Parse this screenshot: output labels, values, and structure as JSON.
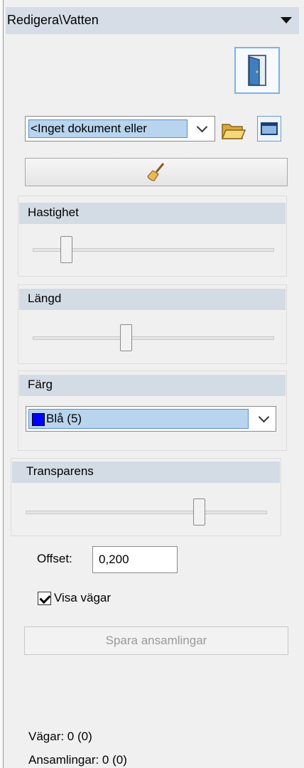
{
  "panel": {
    "title": "Redigera\\Vatten"
  },
  "document": {
    "selected": "<Inget dokument eller"
  },
  "speed": {
    "label": "Hastighet",
    "value_fraction": 0.12
  },
  "length": {
    "label": "Längd",
    "value_fraction": 0.38
  },
  "color": {
    "label": "Färg",
    "selected": "Blå (5)",
    "swatch": "#0000ff"
  },
  "transparency": {
    "label": "Transparens",
    "value_fraction": 0.73
  },
  "offset": {
    "label": "Offset:",
    "value": "0,200"
  },
  "show_roads": {
    "label": "Visa vägar",
    "checked": true
  },
  "save_button": {
    "label": "Spara ansamlingar"
  },
  "stats": {
    "roads": "Vägar: 0 (0)",
    "accumulations": "Ansamlingar: 0 (0)"
  },
  "icons": [
    "door-icon",
    "folder-icon",
    "frame-icon",
    "broom-icon",
    "chevron-down-icon",
    "collapse-arrow-icon"
  ]
}
